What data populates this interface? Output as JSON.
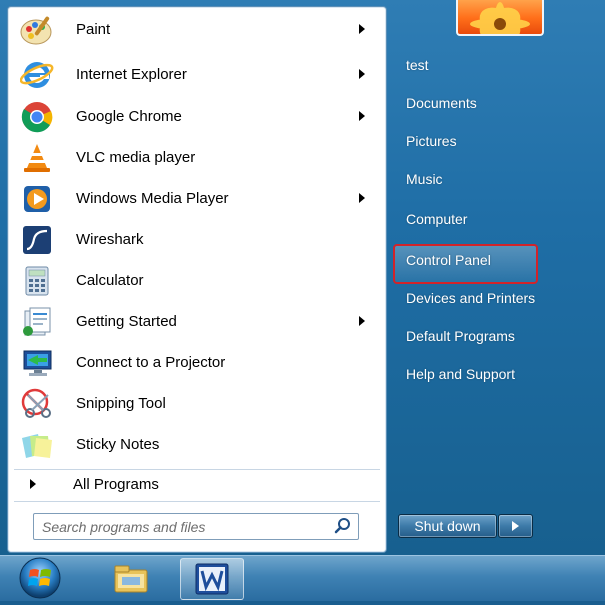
{
  "programs": [
    {
      "label": "Paint",
      "icon": "paint-icon",
      "submenu": true
    },
    {
      "label": "Internet Explorer",
      "icon": "internet-explorer-icon",
      "submenu": true
    },
    {
      "label": "Google Chrome",
      "icon": "chrome-icon",
      "submenu": true
    },
    {
      "label": "VLC media player",
      "icon": "vlc-icon",
      "submenu": false
    },
    {
      "label": "Windows Media Player",
      "icon": "media-player-icon",
      "submenu": true
    },
    {
      "label": "Wireshark",
      "icon": "wireshark-icon",
      "submenu": false
    },
    {
      "label": "Calculator",
      "icon": "calculator-icon",
      "submenu": false
    },
    {
      "label": "Getting Started",
      "icon": "getting-started-icon",
      "submenu": true
    },
    {
      "label": "Connect to a Projector",
      "icon": "projector-icon",
      "submenu": false
    },
    {
      "label": "Snipping Tool",
      "icon": "scissors-icon",
      "submenu": false
    },
    {
      "label": "Sticky Notes",
      "icon": "sticky-notes-icon",
      "submenu": false
    }
  ],
  "all_programs_label": "All Programs",
  "search": {
    "placeholder": "Search programs and files"
  },
  "right_links": [
    {
      "label": "test"
    },
    {
      "label": "Documents"
    },
    {
      "label": "Pictures"
    },
    {
      "label": "Music"
    },
    {
      "label": "Computer"
    },
    {
      "label": "Control Panel"
    },
    {
      "label": "Devices and Printers"
    },
    {
      "label": "Default Programs"
    },
    {
      "label": "Help and Support"
    }
  ],
  "shutdown_label": "Shut down",
  "highlight_color": "#d2232a",
  "taskbar": {
    "items": [
      "start-orb-icon",
      "windows-explorer-icon",
      "word-icon"
    ]
  }
}
